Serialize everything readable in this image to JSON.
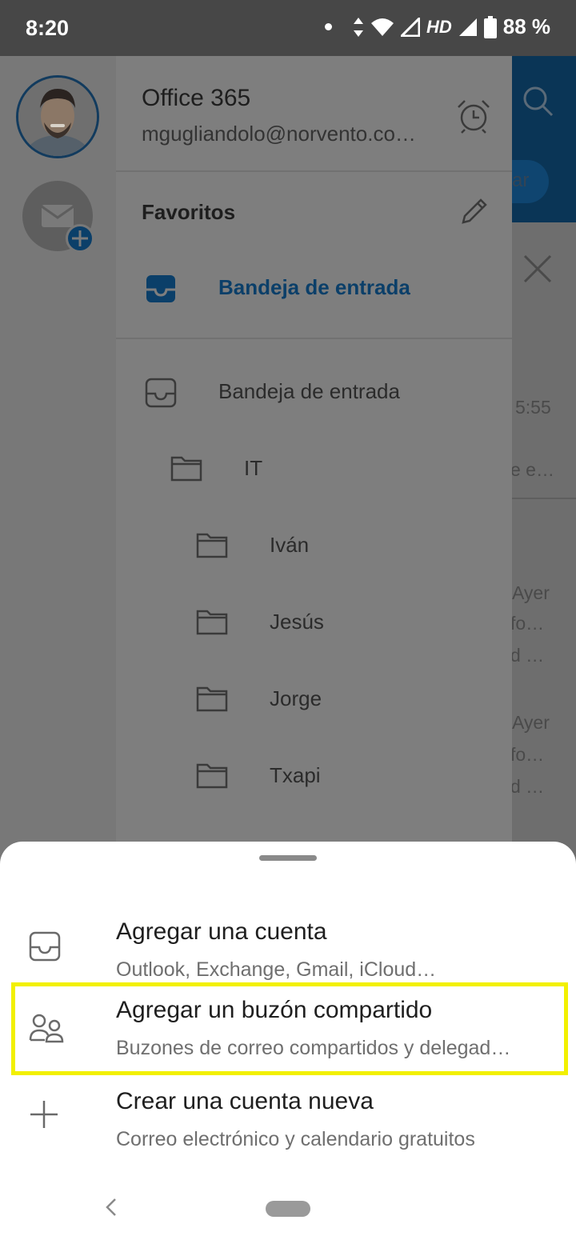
{
  "status_bar": {
    "time": "8:20",
    "network": "HD",
    "battery": "88 %"
  },
  "drawer": {
    "account_name": "Office 365",
    "account_email": "mgugliandolo@norvento.co…",
    "favorites_title": "Favoritos",
    "favorites": [
      {
        "label": "Bandeja de entrada",
        "icon": "inbox-filled-icon"
      }
    ],
    "folders": [
      {
        "label": "Bandeja de entrada",
        "icon": "inbox-icon"
      },
      {
        "label": "IT",
        "icon": "folder-icon"
      },
      {
        "label": "Iván",
        "icon": "folder-icon"
      },
      {
        "label": "Jesús",
        "icon": "folder-icon"
      },
      {
        "label": "Jorge",
        "icon": "folder-icon"
      },
      {
        "label": "Txapi",
        "icon": "folder-icon"
      }
    ]
  },
  "background": {
    "peek_texts": [
      "ar",
      "5:55",
      "e e…",
      "Ayer",
      "fo…",
      "d …",
      "Ayer",
      "fo…",
      "d …"
    ]
  },
  "sheet": {
    "items": [
      {
        "title": "Agregar una cuenta",
        "subtitle": "Outlook, Exchange, Gmail, iCloud…",
        "icon": "inbox-icon"
      },
      {
        "title": "Agregar un buzón compartido",
        "subtitle": "Buzones de correo compartidos y delegad…",
        "icon": "shared-mailbox-icon"
      },
      {
        "title": "Crear una cuenta nueva",
        "subtitle": "Correo electrónico y calendario gratuitos",
        "icon": "plus-icon"
      }
    ]
  },
  "colors": {
    "accent": "#0b3f69",
    "highlight": "#f2f000"
  }
}
